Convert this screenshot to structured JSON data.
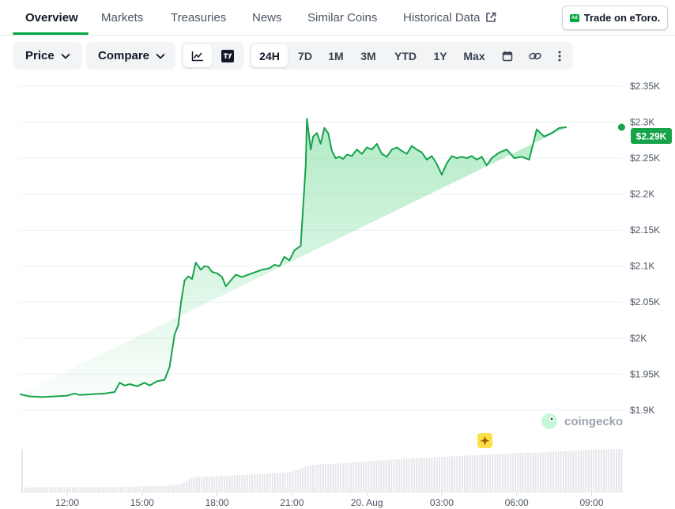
{
  "tabs": {
    "overview": "Overview",
    "markets": "Markets",
    "treasuries": "Treasuries",
    "news": "News",
    "similar_coins": "Similar Coins",
    "historical_data": "Historical Data"
  },
  "ad": {
    "badge": "Ad",
    "label": "Trade on eToro."
  },
  "toolbar": {
    "price": "Price",
    "compare": "Compare",
    "ranges": [
      "24H",
      "7D",
      "1M",
      "3M",
      "YTD",
      "1Y",
      "Max"
    ],
    "active_range": "24H"
  },
  "watermark": {
    "text": "coingecko"
  },
  "colors": {
    "line": "#16a34a",
    "accent": "#00a83e",
    "volume": "#e5e7eb"
  },
  "chart_data": {
    "type": "area",
    "title": "",
    "xlabel": "",
    "ylabel": "",
    "y_tick_labels": [
      "$2.35K",
      "$2.3K",
      "$2.25K",
      "$2.2K",
      "$2.15K",
      "$2.1K",
      "$2.05K",
      "$2K",
      "$1.95K",
      "$1.9K"
    ],
    "y_ticks": [
      2350,
      2300,
      2250,
      2200,
      2150,
      2100,
      2050,
      2000,
      1950,
      1900
    ],
    "ylim": [
      1880,
      2360
    ],
    "x_tick_labels": [
      "12:00",
      "15:00",
      "18:00",
      "21:00",
      "20. Aug",
      "03:00",
      "06:00",
      "09:00"
    ],
    "x_ticks": [
      12,
      15,
      18,
      21,
      24,
      27,
      30,
      33
    ],
    "xlim": [
      10.1,
      34.25
    ],
    "last_value_label": "$2.29K",
    "grid": true,
    "price_series": {
      "name": "",
      "x": [
        10.1,
        10.5,
        11.0,
        11.5,
        12.0,
        12.3,
        12.5,
        13.0,
        13.5,
        13.9,
        14.1,
        14.3,
        14.5,
        14.8,
        15.1,
        15.3,
        15.6,
        15.9,
        16.1,
        16.3,
        16.45,
        16.55,
        16.7,
        16.85,
        17.0,
        17.15,
        17.35,
        17.5,
        17.65,
        17.8,
        18.0,
        18.2,
        18.35,
        18.55,
        18.75,
        19.0,
        19.4,
        19.8,
        20.1,
        20.3,
        20.5,
        20.7,
        20.9,
        21.1,
        21.35,
        21.55,
        21.6,
        21.75,
        21.85,
        22.0,
        22.15,
        22.3,
        22.45,
        22.6,
        22.75,
        22.9,
        23.05,
        23.2,
        23.4,
        23.6,
        23.8,
        24.0,
        24.2,
        24.4,
        24.6,
        24.8,
        25.0,
        25.2,
        25.4,
        25.6,
        25.8,
        26.0,
        26.2,
        26.4,
        26.6,
        26.8,
        27.0,
        27.2,
        27.4,
        27.6,
        27.8,
        28.0,
        28.2,
        28.4,
        28.6,
        28.8,
        29.0,
        29.3,
        29.6,
        29.9,
        30.2,
        30.5,
        30.8,
        31.1,
        31.4,
        31.7,
        32.0,
        32.3,
        32.6,
        32.9,
        33.2,
        33.5,
        33.7,
        33.9,
        34.1,
        34.2
      ],
      "values": [
        1922,
        1919,
        1918,
        1919,
        1920,
        1923,
        1921,
        1922,
        1923,
        1925,
        1938,
        1934,
        1936,
        1933,
        1938,
        1934,
        1940,
        1942,
        1960,
        2005,
        2018,
        2048,
        2080,
        2086,
        2082,
        2105,
        2095,
        2100,
        2099,
        2092,
        2090,
        2085,
        2072,
        2080,
        2088,
        2085,
        2090,
        2095,
        2097,
        2102,
        2100,
        2113,
        2108,
        2122,
        2128,
        2240,
        2305,
        2262,
        2280,
        2285,
        2270,
        2292,
        2285,
        2260,
        2250,
        2252,
        2249,
        2255,
        2253,
        2262,
        2256,
        2265,
        2262,
        2270,
        2256,
        2252,
        2262,
        2265,
        2260,
        2256,
        2267,
        2262,
        2258,
        2248,
        2253,
        2242,
        2227,
        2243,
        2253,
        2250,
        2252,
        2250,
        2253,
        2248,
        2252,
        2240,
        2250,
        2258,
        2262,
        2250,
        2252,
        2248,
        2290,
        2280,
        2285,
        2292,
        2293
      ]
    },
    "volume_series": {
      "name": "",
      "x": [
        10.2,
        11.0,
        12.0,
        13.0,
        14.0,
        15.0,
        16.0,
        16.5,
        17.0,
        18.0,
        19.0,
        20.0,
        21.0,
        21.6,
        22.0,
        23.0,
        24.0,
        25.0,
        26.0,
        27.0,
        28.0,
        29.0,
        30.0,
        31.0,
        32.0,
        33.0,
        34.0,
        34.2
      ],
      "values": [
        6,
        7,
        7,
        7,
        7,
        8,
        9,
        12,
        22,
        24,
        26,
        28,
        31,
        40,
        42,
        44,
        47,
        50,
        52,
        54,
        56,
        58,
        60,
        61,
        63,
        65,
        66,
        66
      ]
    }
  }
}
